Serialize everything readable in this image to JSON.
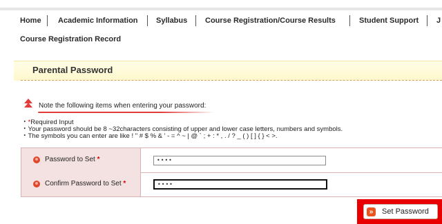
{
  "nav": {
    "items": [
      "Home",
      "Academic Information",
      "Syllabus",
      "Course Registration/Course Results",
      "Student Support",
      "J"
    ],
    "sub": "Course Registration Record"
  },
  "page": {
    "title": "Parental Password"
  },
  "notice": {
    "heading": "Note the following items when entering your password:",
    "lines": {
      "required_prefix": "・",
      "required_mark": "*",
      "required_text": "Required Input",
      "length": "・Your password should be 8 ~32characters consisting of upper and lower case letters, numbers and symbols.",
      "symbols": "・The symbols you can enter are like ! \" # $ % & ' - = ^ ~ | @ ` ; + : * , . / ? _ ( ) [ ] { } < >."
    }
  },
  "form": {
    "password_label": "Password to Set",
    "password_value": "••••",
    "confirm_label": "Confirm Password to Set",
    "confirm_value": "••••",
    "required_mark": "*"
  },
  "actions": {
    "set_password_label": "Set Password",
    "set_password_icon": "»"
  },
  "colors": {
    "accent": "#e0472b",
    "label_bg": "#f4e1e1",
    "highlight": "#e80000"
  }
}
